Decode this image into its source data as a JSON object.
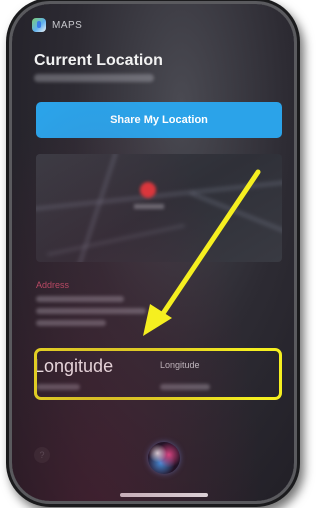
{
  "app": {
    "name": "MAPS"
  },
  "card": {
    "title": "Current Location",
    "share_button": "Share My Location"
  },
  "address": {
    "label": "Address"
  },
  "annotation": {
    "longitude_overlay": "Longitude",
    "longitude_field_label": "Longitude"
  },
  "help": {
    "symbol": "?"
  },
  "colors": {
    "button_blue": "#2ba3e9",
    "highlight_yellow": "#f5ef20",
    "address_label": "#c24f6a"
  }
}
